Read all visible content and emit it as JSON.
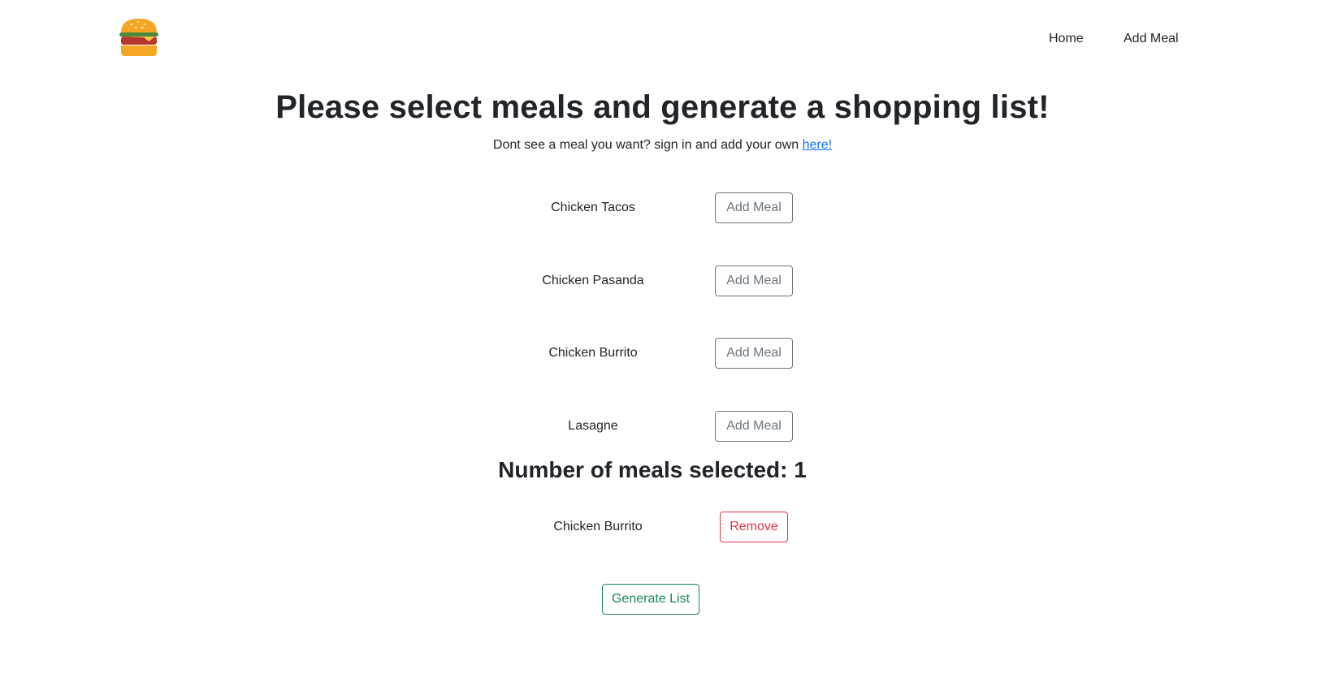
{
  "nav": {
    "logo_icon": "burger-icon",
    "links": [
      {
        "label": "Home"
      },
      {
        "label": "Add Meal"
      }
    ]
  },
  "main": {
    "title": "Please select meals and generate a shopping list!",
    "subtitle_text": "Dont see a meal you want? sign in and add your own ",
    "subtitle_link": "here!",
    "meals": [
      {
        "name": "Chicken Tacos",
        "button_label": "Add Meal"
      },
      {
        "name": "Chicken Pasanda",
        "button_label": "Add Meal"
      },
      {
        "name": "Chicken Burrito",
        "button_label": "Add Meal"
      },
      {
        "name": "Lasagne",
        "button_label": "Add Meal"
      }
    ],
    "selected_count_title": "Number of meals selected: 1",
    "selected": [
      {
        "name": "Chicken Burrito",
        "button_label": "Remove"
      }
    ],
    "generate_label": "Generate List"
  },
  "colors": {
    "add_button": "#6c757d",
    "remove_button": "#dc3545",
    "generate_button": "#198754",
    "link": "#0d6efd"
  }
}
